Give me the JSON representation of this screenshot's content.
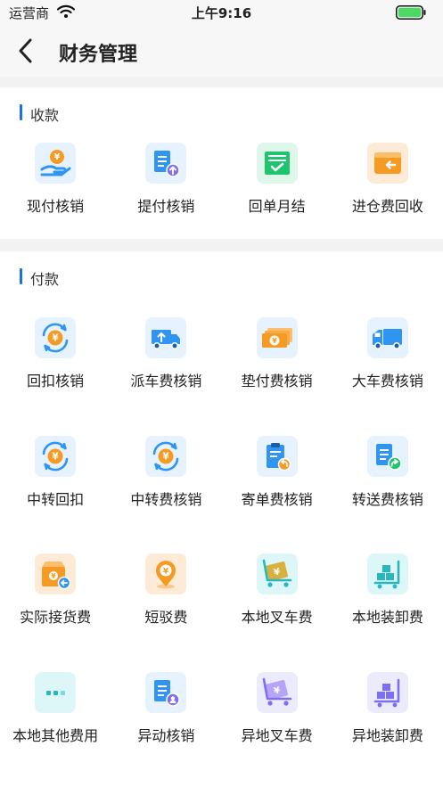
{
  "status_bar": {
    "carrier": "运营商",
    "time": "上午9:16"
  },
  "nav": {
    "title": "财务管理"
  },
  "receive": {
    "title": "收款",
    "items": [
      {
        "label": "现付核销",
        "icon": "yuan-hand-icon"
      },
      {
        "label": "提付核销",
        "icon": "doc-upload-icon"
      },
      {
        "label": "回单月结",
        "icon": "statement-check-icon"
      },
      {
        "label": "进仓费回收",
        "icon": "wallet-return-icon"
      }
    ]
  },
  "pay": {
    "title": "付款",
    "items": [
      {
        "label": "回扣核销",
        "icon": "yuan-cycle-icon"
      },
      {
        "label": "派车费核销",
        "icon": "truck-dispatch-icon"
      },
      {
        "label": "垫付费核销",
        "icon": "cash-bills-icon"
      },
      {
        "label": "大车费核销",
        "icon": "truck-icon"
      },
      {
        "label": "中转回扣",
        "icon": "yuan-cycle-icon"
      },
      {
        "label": "中转费核销",
        "icon": "yuan-cycle-icon"
      },
      {
        "label": "寄单费核销",
        "icon": "clipboard-return-icon"
      },
      {
        "label": "转送费核销",
        "icon": "doc-forward-icon"
      },
      {
        "label": "实际接货费",
        "icon": "box-return-icon"
      },
      {
        "label": "短驳费",
        "icon": "location-yuan-icon"
      },
      {
        "label": "本地叉车费",
        "icon": "forklift-cart-icon"
      },
      {
        "label": "本地装卸费",
        "icon": "boxes-cart-icon"
      },
      {
        "label": "本地其他费用",
        "icon": "more-dots-icon"
      },
      {
        "label": "异动核销",
        "icon": "doc-user-icon"
      },
      {
        "label": "异地叉车费",
        "icon": "forklift-cart-icon"
      },
      {
        "label": "异地装卸费",
        "icon": "boxes-cart-icon"
      }
    ]
  },
  "colors": {
    "accent": "#1a73e8",
    "background": "#f2f2f2",
    "battery": "#4cd964"
  }
}
